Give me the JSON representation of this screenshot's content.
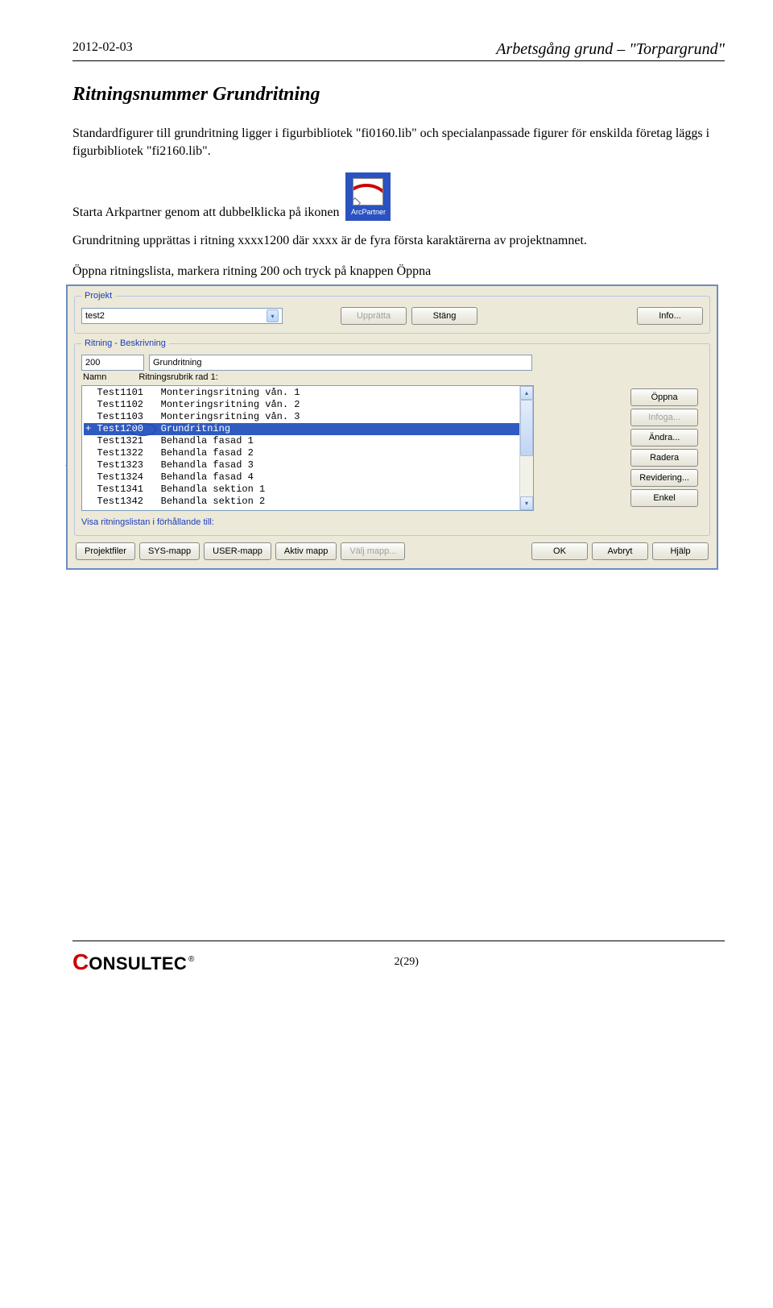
{
  "header": {
    "date": "2012-02-03",
    "title_right": "Arbetsgång grund – \"Torpargrund\""
  },
  "section_title": "Ritningsnummer Grundritning",
  "para1": "Standardfigurer till grundritning ligger i figurbibliotek \"fi0160.lib\" och specialanpassade figurer för enskilda företag läggs i figurbibliotek \"fi2160.lib\".",
  "icon_label": "ArcPartner",
  "para2_prefix": "Starta Arkpartner genom att dubbelklicka på ikonen",
  "para3": "Grundritning upprättas i ritning xxxx1200 där xxxx är de fyra första karaktärerna av projektnamnet.",
  "para4": "Öppna ritningslista, markera ritning 200 och tryck på knappen Öppna",
  "dialog": {
    "projekt_legend": "Projekt",
    "projekt_value": "test2",
    "btn_uppratta": "Upprätta",
    "btn_stang": "Stäng",
    "btn_info": "Info...",
    "ritning_legend": "Ritning - Beskrivning",
    "ritning_num": "200",
    "ritning_desc": "Grundritning",
    "col_namn": "Namn",
    "col_rubrik": "Ritningsrubrik rad 1:",
    "rows": [
      {
        "name": "Test1101",
        "desc": "Monteringsritning vån. 1"
      },
      {
        "name": "Test1102",
        "desc": "Monteringsritning vån. 2"
      },
      {
        "name": "Test1103",
        "desc": "Monteringsritning vån. 3"
      },
      {
        "name": "Test1200",
        "desc": "Grundritning",
        "selected": true,
        "plus": true
      },
      {
        "name": "Test1321",
        "desc": "Behandla fasad 1"
      },
      {
        "name": "Test1322",
        "desc": "Behandla fasad 2"
      },
      {
        "name": "Test1323",
        "desc": "Behandla fasad 3"
      },
      {
        "name": "Test1324",
        "desc": "Behandla fasad 4"
      },
      {
        "name": "Test1341",
        "desc": "Behandla sektion 1"
      },
      {
        "name": "Test1342",
        "desc": "Behandla sektion 2"
      }
    ],
    "right_buttons": {
      "oppna": "Öppna",
      "infoga": "Infoga...",
      "andra": "Ändra...",
      "radera": "Radera",
      "revidering": "Revidering...",
      "enkel": "Enkel"
    },
    "visa_label": "Visa ritningslistan i förhållande till:",
    "bottom": {
      "projektfiler": "Projektfiler",
      "sys": "SYS-mapp",
      "user": "USER-mapp",
      "aktiv": "Aktiv mapp",
      "valj": "Välj mapp...",
      "ok": "OK",
      "avbryt": "Avbryt",
      "hjalp": "Hjälp"
    }
  },
  "footer": {
    "logo_c": "C",
    "logo_rest": "ONSULTEC",
    "page": "2(29)"
  }
}
